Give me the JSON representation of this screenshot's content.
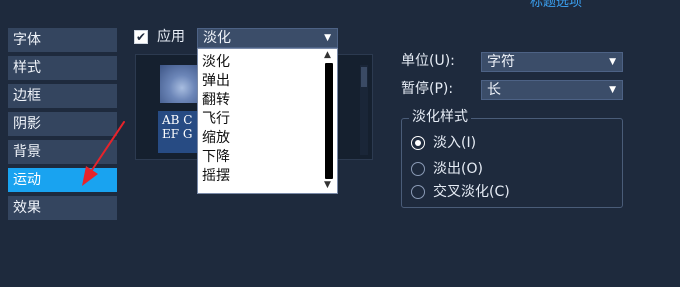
{
  "header": {
    "title": "标题选项"
  },
  "sidebar": {
    "items": [
      {
        "label": "字体"
      },
      {
        "label": "样式"
      },
      {
        "label": "边框"
      },
      {
        "label": "阴影"
      },
      {
        "label": "背景"
      },
      {
        "label": "运动"
      },
      {
        "label": "效果"
      }
    ],
    "active_index": 5
  },
  "apply": {
    "label": "应用",
    "checked": true,
    "check_glyph": "✔"
  },
  "effect_select": {
    "value": "淡化",
    "options": [
      "淡化",
      "弹出",
      "翻转",
      "飞行",
      "缩放",
      "下降",
      "摇摆"
    ]
  },
  "preview": {
    "sample_text": "AB C EF G"
  },
  "unit": {
    "label": "单位(U):",
    "value": "字符"
  },
  "pause": {
    "label": "暂停(P):",
    "value": "长"
  },
  "fade_style": {
    "title": "淡化样式",
    "options": [
      {
        "label": "淡入(I)",
        "checked": true
      },
      {
        "label": "淡出(O)",
        "checked": false
      },
      {
        "label": "交叉淡化(C)",
        "checked": false
      }
    ]
  },
  "colors": {
    "accent": "#19a3f0",
    "background": "#1e2a3d",
    "annotation_arrow": "#e8232a"
  },
  "icons": {
    "dropdown_arrow": "▼",
    "scroll_up": "▲",
    "scroll_down": "▼"
  }
}
